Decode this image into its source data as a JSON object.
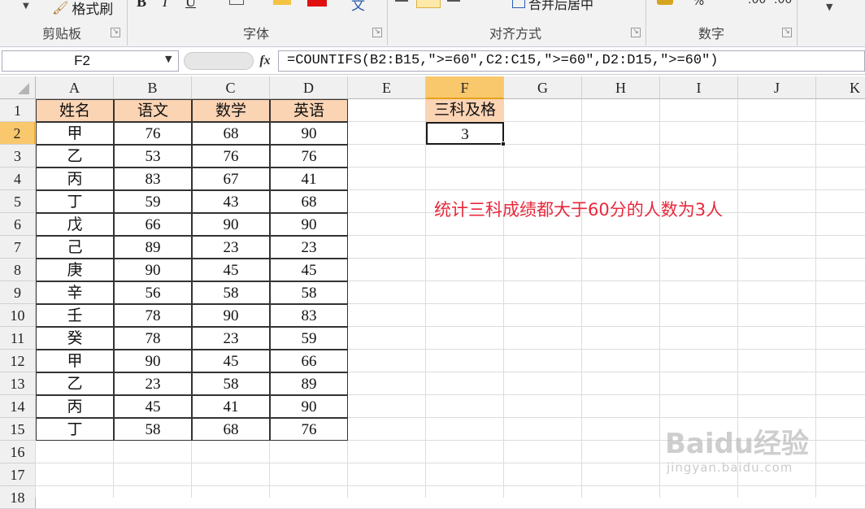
{
  "ribbon": {
    "format_painter_label": "格式刷",
    "groups": [
      {
        "name": "剪贴板"
      },
      {
        "name": "字体"
      },
      {
        "name": "对齐方式"
      },
      {
        "name": "数字"
      }
    ],
    "bold": "B",
    "italic": "I",
    "underline": "U",
    "font_color_letter": "A",
    "wen": "文",
    "merge_center_label": "合并后居中",
    "percent": "%",
    "decimal_inc": ".00",
    "decimal_dec": ".00"
  },
  "formula_bar": {
    "name_box": "F2",
    "fx": "fx",
    "formula": "=COUNTIFS(B2:B15,\">=60\",C2:C15,\">=60\",D2:D15,\">=60\")"
  },
  "columns": [
    "A",
    "B",
    "C",
    "D",
    "E",
    "F",
    "G",
    "H",
    "I",
    "J",
    "K"
  ],
  "rows": [
    "1",
    "2",
    "3",
    "4",
    "5",
    "6",
    "7",
    "8",
    "9",
    "10",
    "11",
    "12",
    "13",
    "14",
    "15",
    "16",
    "17",
    "18"
  ],
  "table": {
    "headers": [
      "姓名",
      "语文",
      "数学",
      "英语"
    ],
    "data": [
      [
        "甲",
        "76",
        "68",
        "90"
      ],
      [
        "乙",
        "53",
        "76",
        "76"
      ],
      [
        "丙",
        "83",
        "67",
        "41"
      ],
      [
        "丁",
        "59",
        "43",
        "68"
      ],
      [
        "戊",
        "66",
        "90",
        "90"
      ],
      [
        "己",
        "89",
        "23",
        "23"
      ],
      [
        "庚",
        "90",
        "45",
        "45"
      ],
      [
        "辛",
        "56",
        "58",
        "58"
      ],
      [
        "壬",
        "78",
        "90",
        "83"
      ],
      [
        "癸",
        "78",
        "23",
        "59"
      ],
      [
        "甲",
        "90",
        "45",
        "66"
      ],
      [
        "乙",
        "23",
        "58",
        "89"
      ],
      [
        "丙",
        "45",
        "41",
        "90"
      ],
      [
        "丁",
        "58",
        "68",
        "76"
      ]
    ]
  },
  "result": {
    "header": "三科及格",
    "value": "3"
  },
  "annotation": "统计三科成绩都大于60分的人数为3人",
  "watermark": {
    "brand": "Baidu经验",
    "url": "jingyan.baidu.com"
  },
  "colors": {
    "header_fill": "#fbd4b4",
    "selected_header": "#f9c76c",
    "annotation": "#e8283c",
    "selection_border": "#1a1a1a"
  }
}
